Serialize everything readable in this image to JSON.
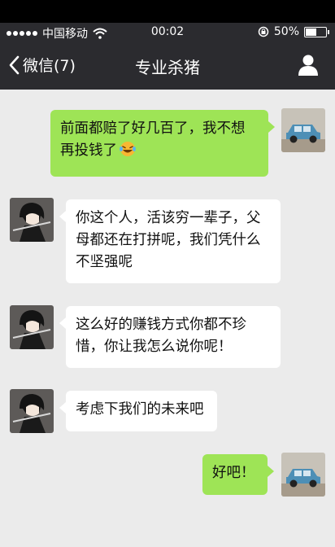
{
  "status_bar": {
    "carrier": "中国移动",
    "time": "00:02",
    "battery": "50%",
    "battery_level": 0.5
  },
  "nav": {
    "back_label": "微信(7)",
    "title": "专业杀猪"
  },
  "messages": [
    {
      "side": "out",
      "text": "前面都赔了好几百了，我不想再投钱了",
      "emoji": "laughing-crying-emoji"
    },
    {
      "side": "in",
      "text": "你这个人，活该穷一辈子，父母都还在打拼呢，我们凭什么不坚强呢"
    },
    {
      "side": "in",
      "text": "这么好的赚钱方式你都不珍惜，你让我怎么说你呢！"
    },
    {
      "side": "in",
      "text": "考虑下我们的未来吧"
    },
    {
      "side": "out",
      "text": "好吧！"
    }
  ],
  "icons": {
    "signal": "signal-dots-icon",
    "wifi": "wifi-icon",
    "lock": "rotation-lock-icon",
    "battery": "battery-icon",
    "back": "chevron-left-icon",
    "profile": "person-icon"
  },
  "colors": {
    "navbar": "#2b2b2f",
    "chat_bg": "#ebebeb",
    "bubble_out": "#9ee456",
    "bubble_in": "#ffffff"
  }
}
